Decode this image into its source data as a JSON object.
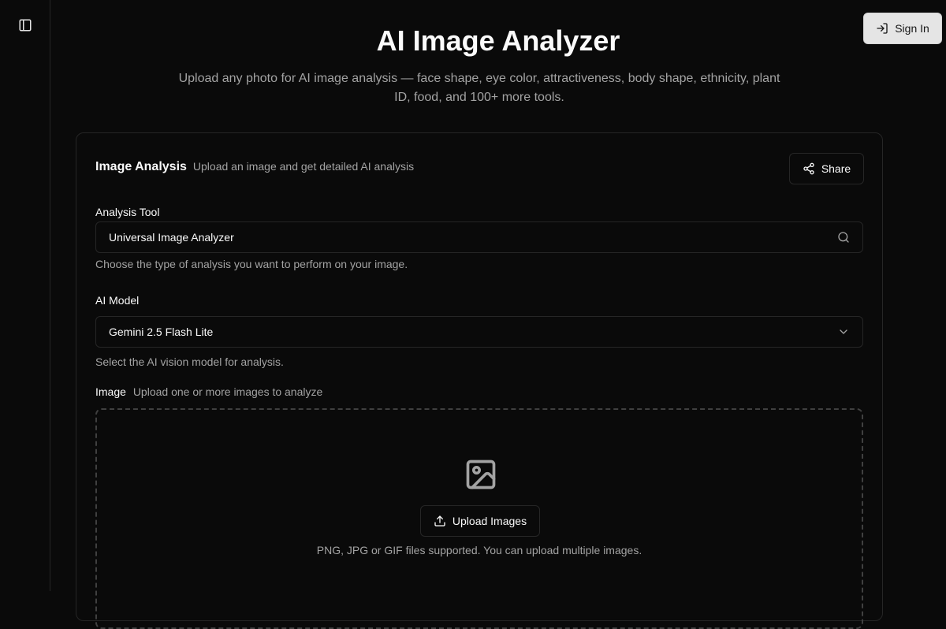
{
  "header": {
    "sign_in_label": "Sign In",
    "title": "AI Image Analyzer",
    "subtitle": "Upload any photo for AI image analysis — face shape, eye color, attractiveness, body shape, ethnicity, plant ID, food, and 100+ more tools."
  },
  "card": {
    "title": "Image Analysis",
    "description": "Upload an image and get detailed AI analysis",
    "share_label": "Share"
  },
  "analysis_tool": {
    "label": "Analysis Tool",
    "value": "Universal Image Analyzer",
    "help": "Choose the type of analysis you want to perform on your image."
  },
  "ai_model": {
    "label": "AI Model",
    "selected": "Gemini 2.5 Flash Lite",
    "help": "Select the AI vision model for analysis."
  },
  "image": {
    "label": "Image",
    "description": "Upload one or more images to analyze",
    "upload_label": "Upload Images",
    "hint": "PNG, JPG or GIF files supported. You can upload multiple images."
  },
  "icons": {
    "sidebar_toggle": "panel-left-icon",
    "sign_in": "log-in-icon",
    "share": "share-icon",
    "search": "search-icon",
    "chevron": "chevron-down-icon",
    "image": "image-icon",
    "upload": "upload-icon"
  },
  "colors": {
    "background": "#0a0a0a",
    "border": "#262626",
    "muted_text": "#a3a3a3",
    "sign_in_bg": "#e5e5e5"
  }
}
